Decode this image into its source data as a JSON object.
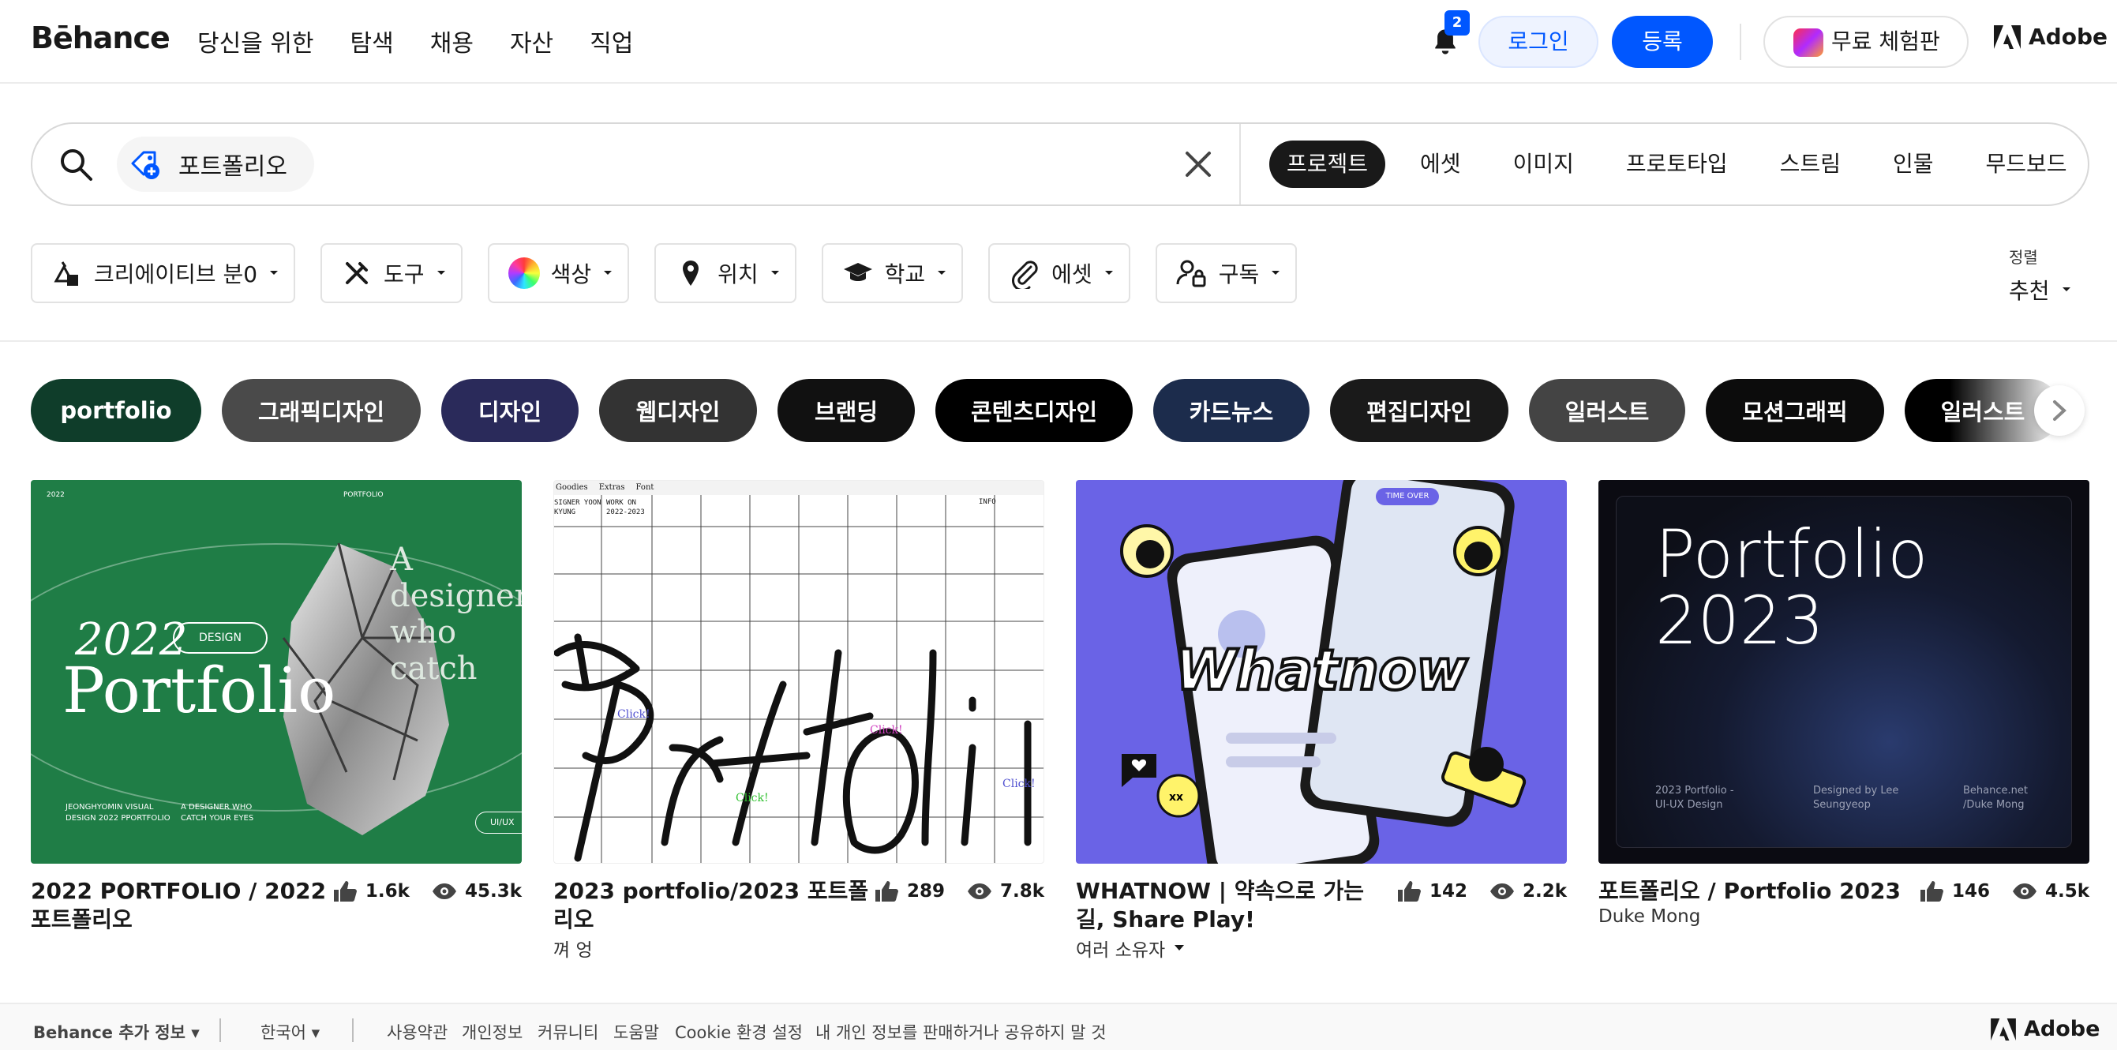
{
  "header": {
    "logo": "Bēhance",
    "nav": [
      "당신을 위한",
      "탐색",
      "채용",
      "자산",
      "직업"
    ],
    "notification_count": "2",
    "login": "로그인",
    "signup": "등록",
    "trial": "무료 체험판",
    "adobe": "Adobe"
  },
  "search": {
    "query_chip": "포트폴리오",
    "tabs": [
      "프로젝트",
      "에셋",
      "이미지",
      "프로토타입",
      "스트림",
      "인물",
      "무드보드"
    ],
    "active_tab": "프로젝트"
  },
  "filters": [
    {
      "label": "크리에이티브 분0",
      "icon": "creative-fields-icon"
    },
    {
      "label": "도구",
      "icon": "tools-icon"
    },
    {
      "label": "색상",
      "icon": "color-wheel-icon"
    },
    {
      "label": "위치",
      "icon": "location-pin-icon"
    },
    {
      "label": "학교",
      "icon": "graduation-cap-icon"
    },
    {
      "label": "에셋",
      "icon": "paperclip-icon"
    },
    {
      "label": "구독",
      "icon": "subscription-icon"
    }
  ],
  "sort": {
    "label": "정렬",
    "value": "추천"
  },
  "tags": [
    {
      "label": "portfolio",
      "bg": "#0f3d2a"
    },
    {
      "label": "그래픽디자인",
      "bg": "#4a4a4a"
    },
    {
      "label": "디자인",
      "bg": "#2a2a5a"
    },
    {
      "label": "웹디자인",
      "bg": "#333333"
    },
    {
      "label": "브랜딩",
      "bg": "#111111"
    },
    {
      "label": "콘텐츠디자인",
      "bg": "#000000"
    },
    {
      "label": "카드뉴스",
      "bg": "#1c2c4c"
    },
    {
      "label": "편집디자인",
      "bg": "#1a1a1a"
    },
    {
      "label": "일러스트",
      "bg": "#444444"
    },
    {
      "label": "모션그래픽",
      "bg": "#0c0c0c"
    },
    {
      "label": "일러스트",
      "bg": "#000000"
    }
  ],
  "projects": [
    {
      "title": "2022 PORTFOLIO / 2022 포트폴리오",
      "owner": "",
      "likes": "1.6k",
      "views": "45.3k",
      "thumb": {
        "top_left": "2022",
        "top_center": "PORTFOLIO",
        "headline": "A designer who catch",
        "year": "2022",
        "badge": "DESIGN",
        "word": "Portfolio",
        "bottom_left": "JEONGHYOMIN VISUAL DESIGN 2022 PPORTFOLIO",
        "bottom_mid": "A DESIGNER WHO CATCH YOUR EYES",
        "bottom_right": "UI/UX"
      }
    },
    {
      "title": "2023 portfolio/2023 포트폴리오",
      "owner": "껴 엉",
      "likes": "289",
      "views": "7.8k",
      "thumb": {
        "menu": [
          "Goodies",
          "Extras",
          "Font"
        ],
        "col1": "SIGNER YOON KYUNG",
        "col2": "WORK ON 2022-2023",
        "col3": "INFO",
        "click": "Click!"
      }
    },
    {
      "title": "WHATNOW | 약속으로 가는 길, Share Play!",
      "owner": "여러 소유자",
      "likes": "142",
      "views": "2.2k",
      "thumb": {
        "brand": "Whatnow",
        "time_chip": "TIME OVER"
      }
    },
    {
      "title": "포트폴리오 / Portfolio 2023",
      "owner": "Duke Mong",
      "likes": "146",
      "views": "4.5k",
      "thumb": {
        "line1": "Portfolio",
        "line2": "2023",
        "foot1": "2023 Portfolio - UI-UX Design",
        "foot2": "Designed by Lee Seungyeop",
        "foot3": "Behance.net /Duke Mong"
      }
    }
  ],
  "footer": {
    "more": "Behance 추가 정보",
    "language": "한국어",
    "links": [
      "사용약관",
      "개인정보",
      "커뮤니티",
      "도움말",
      "Cookie 환경 설정",
      "내 개인 정보를 판매하거나 공유하지 말 것"
    ],
    "adobe": "Adobe"
  },
  "colors": {
    "accent": "#0057ff",
    "text": "#191919"
  }
}
